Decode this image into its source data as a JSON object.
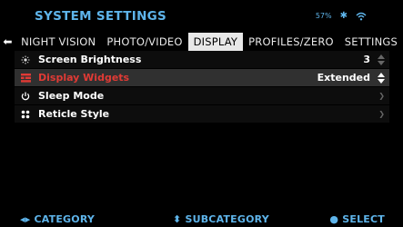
{
  "header": {
    "title": "SYSTEM SETTINGS",
    "battery": "57%"
  },
  "tabs": [
    "NIGHT VISION",
    "PHOTO/VIDEO",
    "DISPLAY",
    "PROFILES/ZERO",
    "SETTINGS"
  ],
  "menu": {
    "items": [
      {
        "label": "Screen Brightness",
        "value": "3",
        "icon": "brightness-icon"
      },
      {
        "label": "Display Widgets",
        "value": "Extended",
        "icon": "widgets-icon"
      },
      {
        "label": "Sleep Mode",
        "value": "",
        "icon": "power-icon"
      },
      {
        "label": "Reticle Style",
        "value": "",
        "icon": "grid-icon"
      }
    ]
  },
  "footer": {
    "category": "CATEGORY",
    "subcategory": "SUBCATEGORY",
    "select": "SELECT"
  },
  "colors": {
    "accent": "#5eb4ea",
    "highlight": "#e03a35"
  }
}
